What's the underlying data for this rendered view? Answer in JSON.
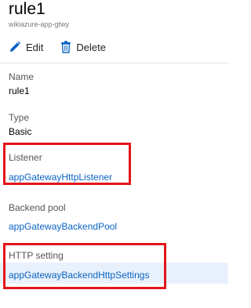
{
  "header": {
    "title": "rule1",
    "subtitle": "wikiazure-app-gtwy"
  },
  "toolbar": {
    "edit_label": "Edit",
    "delete_label": "Delete"
  },
  "fields": {
    "name": {
      "label": "Name",
      "value": "rule1"
    },
    "type": {
      "label": "Type",
      "value": "Basic"
    },
    "listener": {
      "label": "Listener",
      "value": "appGatewayHttpListener"
    },
    "backend_pool": {
      "label": "Backend pool",
      "value": "appGatewayBackendPool"
    },
    "http_setting": {
      "label": "HTTP setting",
      "value": "appGatewayBackendHttpSettings"
    }
  },
  "colors": {
    "link": "#0b63c4",
    "highlight_box": "#e3141c",
    "selected_row": "#e8f1fb",
    "edit_icon": "#0b63c4"
  },
  "icons": {
    "edit": "pencil-icon",
    "delete": "trash-icon"
  }
}
